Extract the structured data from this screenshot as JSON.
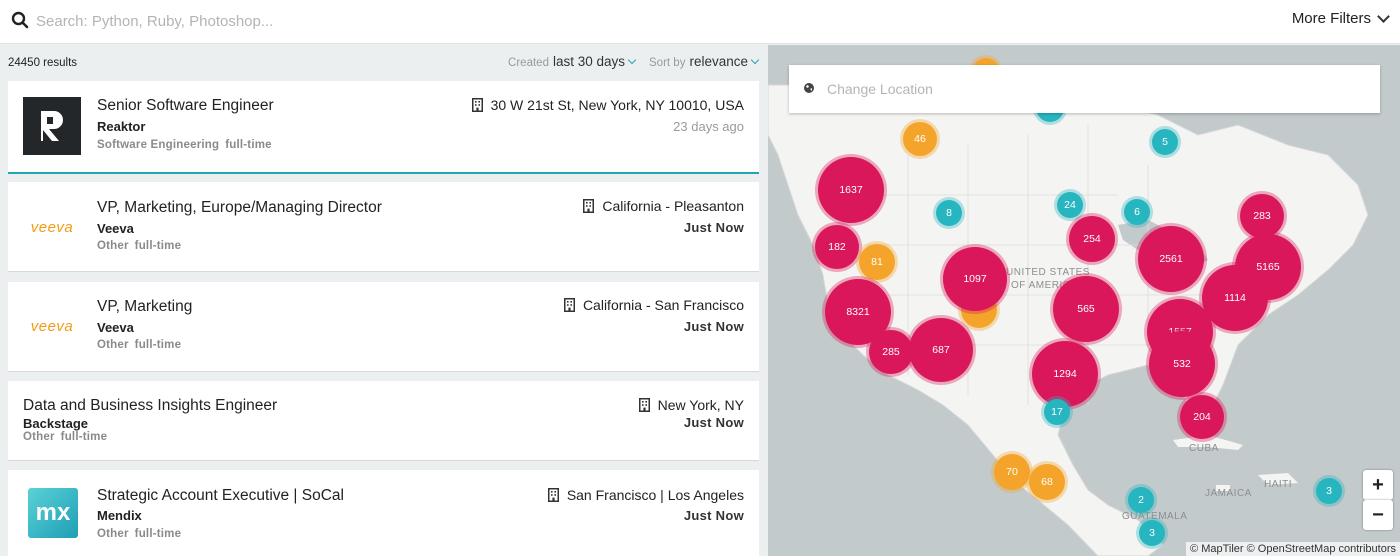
{
  "search": {
    "placeholder": "Search: Python, Ruby, Photoshop..."
  },
  "filters": {
    "more_label": "More Filters"
  },
  "results": {
    "count_label": "24450 results",
    "created_prefix": "Created",
    "created_value": "last 30 days",
    "sort_prefix": "Sort by",
    "sort_value": "relevance"
  },
  "jobs": [
    {
      "title": "Senior Software Engineer",
      "company": "Reaktor",
      "category": "Software Engineering",
      "type": "full-time",
      "location": "30 W 21st St, New York, NY 10010, USA",
      "posted": "23 days ago",
      "logo": "reaktor-logo"
    },
    {
      "title": "VP, Marketing, Europe/Managing Director",
      "company": "Veeva",
      "category": "Other",
      "type": "full-time",
      "location": "California - Pleasanton",
      "posted": "Just Now",
      "logo": "veeva-logo",
      "logo_text": "veeva"
    },
    {
      "title": "VP, Marketing",
      "company": "Veeva",
      "category": "Other",
      "type": "full-time",
      "location": "California - San Francisco",
      "posted": "Just Now",
      "logo": "veeva-logo",
      "logo_text": "veeva"
    },
    {
      "title": "Data and Business Insights Engineer",
      "company": "Backstage",
      "category": "Other",
      "type": "full-time",
      "location": "New York, NY",
      "posted": "Just Now"
    },
    {
      "title": "Strategic Account Executive | SoCal",
      "company": "Mendix",
      "category": "Other",
      "type": "full-time",
      "location": "San Francisco | Los Angeles",
      "posted": "Just Now",
      "logo": "mendix-logo",
      "logo_text": "mx"
    }
  ],
  "map": {
    "location_placeholder": "Change Location",
    "labels": {
      "usa": "UNITED STATES",
      "usa2": "OF AMERICA",
      "cuba": "CUBA",
      "jamaica": "JAMAICA",
      "haiti": "HAITI",
      "guatemala": "GUATEMALA"
    },
    "clusters": [
      "46",
      "5",
      "1637",
      "182",
      "8",
      "24",
      "6",
      "283",
      "254",
      "81",
      "2561",
      "5165",
      "1097",
      "8321",
      "565",
      "1114",
      "1557",
      "285",
      "687",
      "532",
      "1294",
      "17",
      "204",
      "70",
      "68",
      "2",
      "3",
      "3"
    ],
    "zoom_in": "+",
    "zoom_out": "−",
    "attribution": "© MapTiler © OpenStreetMap contributors"
  },
  "colors": {
    "accent": "#21a6b4",
    "cluster_red": "#d9175a",
    "cluster_teal": "#27b5c0",
    "cluster_orange": "#f4a42a"
  }
}
